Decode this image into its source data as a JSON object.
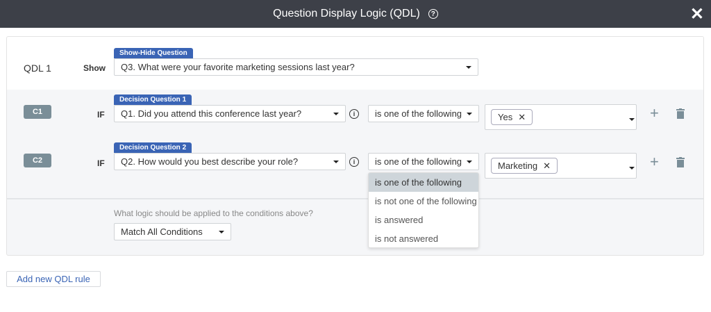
{
  "header": {
    "title": "Question Display Logic (QDL)",
    "help_icon": "?",
    "close_icon": "✕"
  },
  "rule": {
    "name": "QDL 1",
    "show_label": "Show",
    "target_tag": "Show-Hide Question",
    "target_question": "Q3. What were your favorite marketing sessions last year?",
    "conditions": [
      {
        "id": "C1",
        "if_label": "IF",
        "tag": "Decision Question 1",
        "question": "Q1. Did you attend this conference last year?",
        "operator": "is one of the following",
        "values": [
          "Yes"
        ]
      },
      {
        "id": "C2",
        "if_label": "IF",
        "tag": "Decision Question 2",
        "question": "Q2. How would you best describe your role?",
        "operator": "is one of the following",
        "values": [
          "Marketing"
        ]
      }
    ],
    "operator_menu": {
      "options": [
        "is one of the following",
        "is not one of the following",
        "is answered",
        "is not answered"
      ],
      "highlighted": "is one of the following"
    },
    "logic_prompt": "What logic should be applied to the conditions above?",
    "logic_value": "Match All Conditions"
  },
  "add_rule_label": "Add new QDL rule",
  "colors": {
    "header": "#3d4048",
    "accent": "#3a64b5",
    "badge": "#7a8e98"
  }
}
